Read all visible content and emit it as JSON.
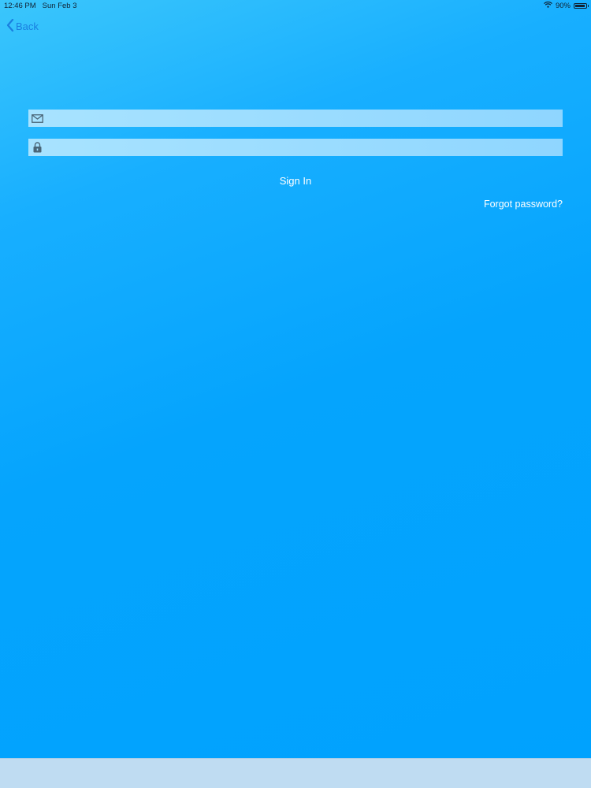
{
  "status_bar": {
    "time": "12:46 PM",
    "date": "Sun Feb 3",
    "battery_percent": "90%",
    "battery_level": 0.9
  },
  "nav": {
    "back_label": "Back"
  },
  "form": {
    "email_value": "",
    "password_value": "",
    "sign_in_label": "Sign In",
    "forgot_label": "Forgot password?"
  },
  "icons": {
    "email": "envelope-icon",
    "password": "lock-icon",
    "back": "chevron-left-icon"
  },
  "colors": {
    "background": "#00a2fe",
    "field": "#a8e3ff",
    "link": "#1a7fe0",
    "bottom_bar": "#bfdcf2"
  }
}
